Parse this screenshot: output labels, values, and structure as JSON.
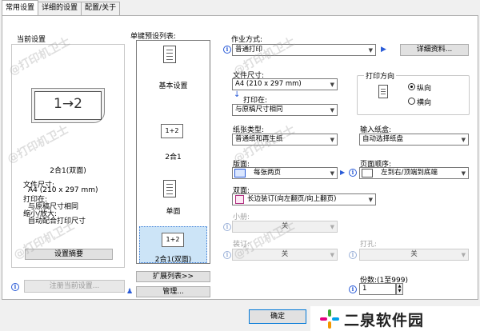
{
  "tabs": [
    "常用设置",
    "详细的设置",
    "配置/关于"
  ],
  "current_settings": {
    "title": "当前设置",
    "diagram": "1→2",
    "caption": "2合1(双面)",
    "details": [
      "文件尺寸:",
      "A4 (210 x 297 mm)",
      "打印在:",
      "与原稿尺寸相同",
      "缩小/放大:",
      "自动配合打印尺寸"
    ],
    "summary_button": "设置摘要",
    "register_button": "注册当前设置..."
  },
  "presets": {
    "title": "单键预设列表:",
    "items": [
      {
        "label": "基本设置",
        "icon": "document-icon"
      },
      {
        "label": "2合1",
        "icon": "two-in-one-icon",
        "glyph": "1+2"
      },
      {
        "label": "单面",
        "icon": "document-icon"
      },
      {
        "label": "2合1(双面)",
        "icon": "two-in-one-icon",
        "glyph": "1+2"
      }
    ],
    "expand_button": "扩展列表>>",
    "manage_button": "管理..."
  },
  "job": {
    "label": "作业方式:",
    "value": "普通打印",
    "detail_button": "详细资料..."
  },
  "paper": {
    "size_label": "文件尺寸:",
    "size_value": "A4 (210 x 297 mm)",
    "print_on_label": "打印在:",
    "print_on_value": "与原稿尺寸相同",
    "orientation_title": "打印方向",
    "portrait": "纵向",
    "landscape": "横向",
    "type_label": "纸张类型:",
    "type_value": "普通纸和再生纸",
    "source_label": "输入纸盒:",
    "source_value": "自动选择纸盘"
  },
  "layout": {
    "page_layout_label": "版面:",
    "page_layout_value": "每张两页",
    "page_order_label": "页面顺序:",
    "page_order_value": "左到右/顶端到底端",
    "duplex_label": "双面:",
    "duplex_value": "长边装订(向左翻页/向上翻页)",
    "booklet_label": "小册:",
    "booklet_value": "关",
    "staple_label": "装订:",
    "staple_value": "关",
    "punch_label": "打孔:",
    "punch_value": "关",
    "copies_label": "份数:(1至999)",
    "copies_value": "1"
  },
  "footer": {
    "ok_button": "确定",
    "watermark_text": "二泉软件园"
  },
  "watermark": "@打印机卫士",
  "colors": {
    "accent": "#2a5bd7",
    "logo_green": "#3aa935",
    "logo_orange": "#f39800"
  }
}
